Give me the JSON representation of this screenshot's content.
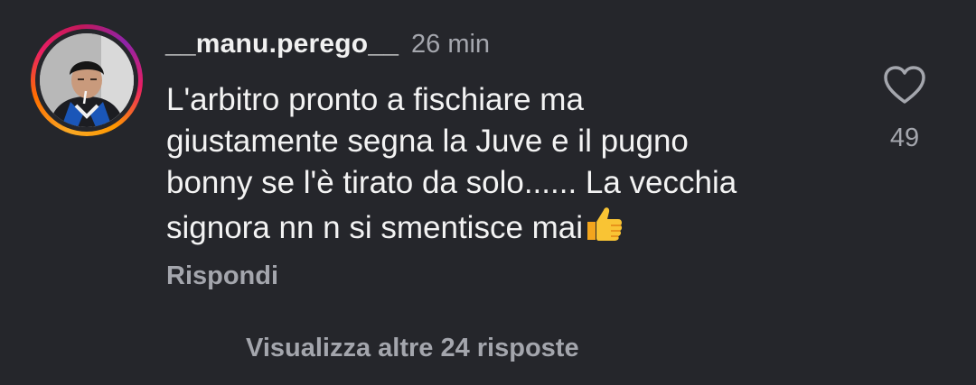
{
  "comment": {
    "username": "__manu.perego__",
    "time": "26 min",
    "text_lines": [
      "L'arbitro pronto a fischiare ma",
      "giustamente segna la Juve e il pugno",
      "bonny se l'è tirato da solo...... La vecchia",
      "signora nn n si smentisce mai"
    ],
    "emoji": "thumbs-up",
    "reply_label": "Rispondi",
    "likes": "49"
  },
  "thread": {
    "more_replies_label": "Visualizza altre 24 risposte"
  },
  "icons": {
    "like": "heart-outline-icon",
    "emoji": "thumbs-up-emoji"
  },
  "colors": {
    "background": "#25262b",
    "primary_text": "#f1f1f1",
    "secondary_text": "#a4a6ad"
  }
}
